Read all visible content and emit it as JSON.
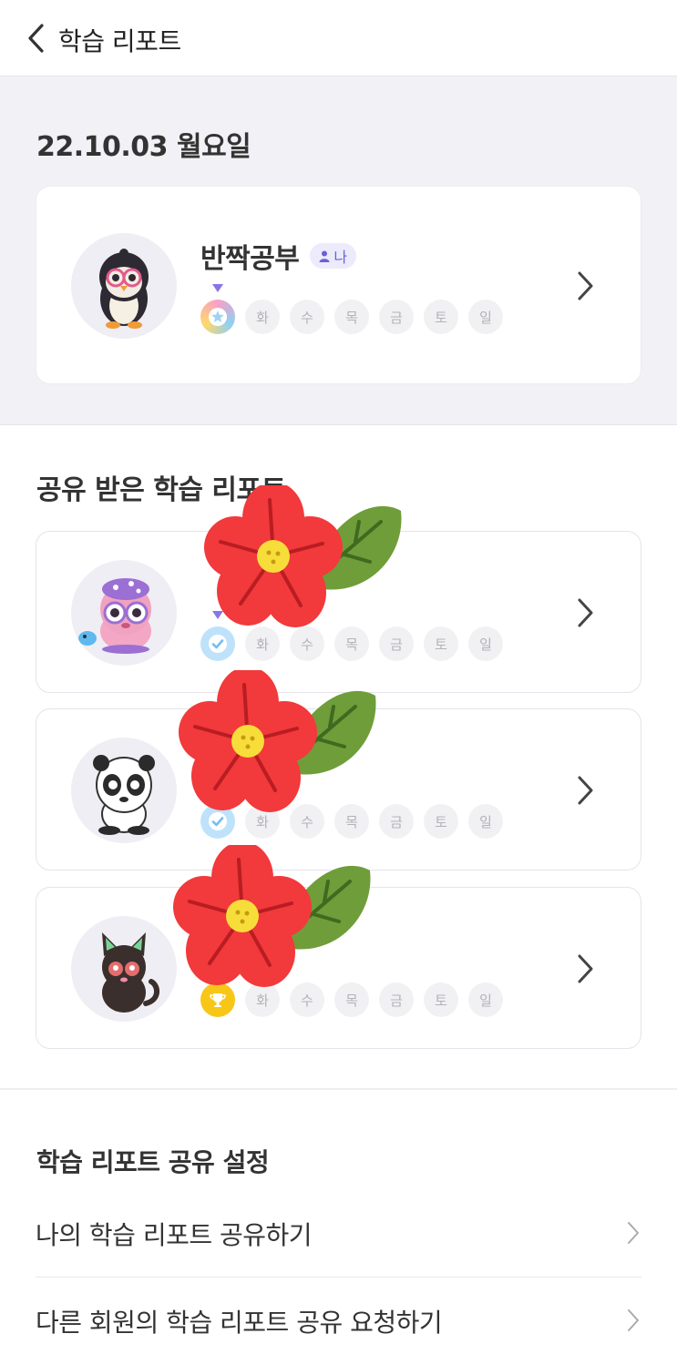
{
  "header": {
    "title": "학습 리포트",
    "back_icon": "chevron-left-icon"
  },
  "today": {
    "date": "22.10.03 월요일",
    "card": {
      "name": "반짝공부",
      "badge": "나",
      "medal": "star-medal-icon",
      "days": [
        "화",
        "수",
        "목",
        "금",
        "토",
        "일"
      ]
    }
  },
  "shared": {
    "title": "공유 받은 학습 리포트",
    "cards": [
      {
        "medal": "check-medal-icon",
        "days": [
          "화",
          "수",
          "목",
          "금",
          "토",
          "일"
        ]
      },
      {
        "medal": "check-medal-icon",
        "days": [
          "화",
          "수",
          "목",
          "금",
          "토",
          "일"
        ]
      },
      {
        "medal": "trophy-medal-icon",
        "days": [
          "화",
          "수",
          "목",
          "금",
          "토",
          "일"
        ]
      }
    ]
  },
  "settings": {
    "title": "학습 리포트 공유 설정",
    "items": [
      {
        "label": "나의 학습 리포트 공유하기"
      },
      {
        "label": "다른 회원의 학습 리포트 공유 요청하기"
      }
    ]
  },
  "colors": {
    "accent": "#8b74e6",
    "background": "#f2f2f6",
    "day_chip": "#f1f1f3"
  }
}
